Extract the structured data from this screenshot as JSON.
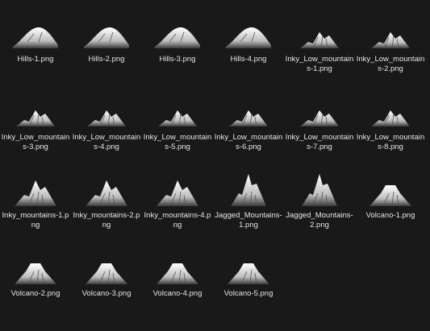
{
  "files": [
    {
      "name": "Hills-1.png",
      "icon": "hill-thumbnail-icon",
      "kind": "hill"
    },
    {
      "name": "Hills-2.png",
      "icon": "hill-thumbnail-icon",
      "kind": "hill"
    },
    {
      "name": "Hills-3.png",
      "icon": "hill-thumbnail-icon",
      "kind": "hill"
    },
    {
      "name": "Hills-4.png",
      "icon": "hill-thumbnail-icon",
      "kind": "hill"
    },
    {
      "name": "Inky_Low_mountains-1.png",
      "icon": "mountain-thumbnail-icon",
      "kind": "low"
    },
    {
      "name": "Inky_Low_mountains-2.png",
      "icon": "mountain-thumbnail-icon",
      "kind": "low"
    },
    {
      "name": "Inky_Low_mountains-3.png",
      "icon": "mountain-thumbnail-icon",
      "kind": "low"
    },
    {
      "name": "Inky_Low_mountains-4.png",
      "icon": "mountain-thumbnail-icon",
      "kind": "low"
    },
    {
      "name": "Inky_Low_mountains-5.png",
      "icon": "mountain-thumbnail-icon",
      "kind": "low"
    },
    {
      "name": "Inky_Low_mountains-6.png",
      "icon": "mountain-thumbnail-icon",
      "kind": "low"
    },
    {
      "name": "Inky_Low_mountains-7.png",
      "icon": "mountain-thumbnail-icon",
      "kind": "low"
    },
    {
      "name": "Inky_Low_mountains-8.png",
      "icon": "mountain-thumbnail-icon",
      "kind": "low"
    },
    {
      "name": "Inky_mountains-1.png",
      "icon": "mountain-thumbnail-icon",
      "kind": "tall"
    },
    {
      "name": "Inky_mountains-2.png",
      "icon": "mountain-thumbnail-icon",
      "kind": "tall"
    },
    {
      "name": "Inky_mountains-4.png",
      "icon": "mountain-thumbnail-icon",
      "kind": "tall"
    },
    {
      "name": "Jagged_Mountains-1.png",
      "icon": "jagged-mountain-thumbnail-icon",
      "kind": "jagged"
    },
    {
      "name": "Jagged_Mountains-2.png",
      "icon": "jagged-mountain-thumbnail-icon",
      "kind": "jagged"
    },
    {
      "name": "Volcano-1.png",
      "icon": "volcano-thumbnail-icon",
      "kind": "volcano"
    },
    {
      "name": "Volcano-2.png",
      "icon": "volcano-thumbnail-icon",
      "kind": "volcano"
    },
    {
      "name": "Volcano-3.png",
      "icon": "volcano-thumbnail-icon",
      "kind": "volcano"
    },
    {
      "name": "Volcano-4.png",
      "icon": "volcano-thumbnail-icon",
      "kind": "volcano"
    },
    {
      "name": "Volcano-5.png",
      "icon": "volcano-thumbnail-icon",
      "kind": "volcano"
    }
  ],
  "colors": {
    "background": "#191919",
    "label_text": "#e6e6e6"
  }
}
